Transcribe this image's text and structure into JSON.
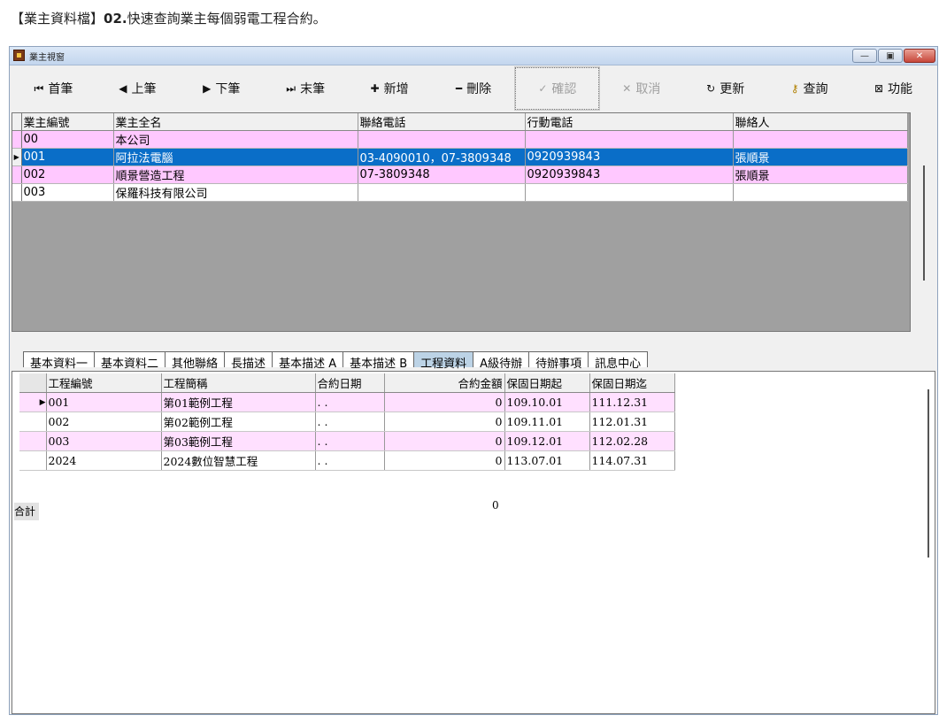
{
  "page": {
    "heading_prefix": "【業主資料檔】",
    "heading_bold": "02.",
    "heading_rest": "快速查詢業主每個弱電工程合約。"
  },
  "window": {
    "title": "業主視窗"
  },
  "toolbar": {
    "first": "首筆",
    "prev": "上筆",
    "next": "下筆",
    "last": "末筆",
    "add": "新增",
    "delete": "刪除",
    "confirm": "確認",
    "cancel": "取消",
    "refresh": "更新",
    "query": "查詢",
    "function": "功能"
  },
  "owners": {
    "columns": [
      "業主編號",
      "業主全名",
      "聯絡電話",
      "行動電話",
      "聯絡人"
    ],
    "rows": [
      {
        "id": "00",
        "name": "本公司",
        "phone": "",
        "mobile": "",
        "contact": ""
      },
      {
        "id": "001",
        "name": "阿拉法電腦",
        "phone": "03-4090010，07-3809348",
        "mobile": "0920939843",
        "contact": "張順景"
      },
      {
        "id": "002",
        "name": "順景營造工程",
        "phone": "07-3809348",
        "mobile": "0920939843",
        "contact": "張順景"
      },
      {
        "id": "003",
        "name": "保羅科技有限公司",
        "phone": "",
        "mobile": "",
        "contact": ""
      }
    ]
  },
  "tabs": [
    "基本資料一",
    "基本資料二",
    "其他聯絡",
    "長描述",
    "基本描述 A",
    "基本描述 B",
    "工程資料",
    "A級待辦",
    "待辦事項",
    "訊息中心"
  ],
  "projects": {
    "columns": [
      "工程編號",
      "工程簡稱",
      "合約日期",
      "合約金額",
      "保固日期起",
      "保固日期迄"
    ],
    "rows": [
      {
        "id": "001",
        "name": "第01範例工程",
        "date": ". .",
        "amount": "0",
        "start": "109.10.01",
        "end": "111.12.31"
      },
      {
        "id": "002",
        "name": "第02範例工程",
        "date": ". .",
        "amount": "0",
        "start": "109.11.01",
        "end": "112.01.31"
      },
      {
        "id": "003",
        "name": "第03範例工程",
        "date": ". .",
        "amount": "0",
        "start": "109.12.01",
        "end": "112.02.28"
      },
      {
        "id": "2024",
        "name": "2024數位智慧工程",
        "date": ". .",
        "amount": "0",
        "start": "113.07.01",
        "end": "114.07.31"
      }
    ],
    "total_label": "合計",
    "total_amount": "0"
  }
}
